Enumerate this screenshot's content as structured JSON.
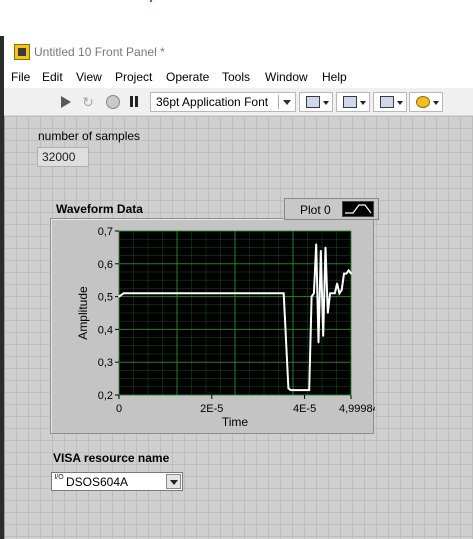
{
  "window": {
    "title": "Untitled 10 Front Panel *"
  },
  "menu": [
    "File",
    "Edit",
    "View",
    "Project",
    "Operate",
    "Tools",
    "Window",
    "Help"
  ],
  "toolbar": {
    "font_label": "36pt Application Font",
    "icons": [
      "run-arrow-icon",
      "run-continuous-icon",
      "abort-icon",
      "pause-icon",
      "align-icon",
      "distribute-icon",
      "resize-icon",
      "reorder-icon"
    ]
  },
  "controls": {
    "num_samples_label": "number of samples",
    "num_samples_value": "32000",
    "graph_label": "Waveform Data",
    "plot_legend": "Plot 0",
    "visa_label": "VISA resource name",
    "visa_value": "DSOS604A",
    "visa_icon_text": "I/O"
  },
  "colors": {
    "plot_bg": "#000000",
    "grid": "#2a8f2a",
    "trace": "#ffffff"
  },
  "chart_data": {
    "type": "line",
    "title": "",
    "xlabel": "Time",
    "ylabel": "Amplitude",
    "xlim": [
      0,
      4.999844e-05
    ],
    "ylim": [
      0.2,
      0.7
    ],
    "x_tick_labels": [
      "0",
      "2E-5",
      "4E-5",
      "4,999844E-"
    ],
    "y_tick_labels": [
      "0,2",
      "0,3",
      "0,4",
      "0,5",
      "0,6",
      "0,7"
    ],
    "grid": true,
    "series": [
      {
        "x": [
          0,
          1e-06,
          5e-06,
          1e-05,
          1.5e-05,
          2e-05,
          2.5e-05,
          3e-05,
          3.55e-05,
          3.65e-05,
          3.7e-05,
          3.8e-05,
          3.9e-05,
          4e-05,
          4.1e-05,
          4.15e-05,
          4.2e-05,
          4.25e-05,
          4.3e-05,
          4.35e-05,
          4.4e-05,
          4.45e-05,
          4.5e-05,
          4.55e-05,
          4.6e-05,
          4.65e-05,
          4.7e-05,
          4.75e-05,
          4.8e-05,
          4.85e-05,
          4.9e-05,
          4.95e-05,
          4.999844e-05
        ],
        "values": [
          0.5,
          0.51,
          0.51,
          0.51,
          0.51,
          0.51,
          0.51,
          0.51,
          0.51,
          0.22,
          0.215,
          0.215,
          0.215,
          0.215,
          0.215,
          0.5,
          0.51,
          0.66,
          0.36,
          0.64,
          0.38,
          0.65,
          0.45,
          0.51,
          0.51,
          0.51,
          0.54,
          0.51,
          0.52,
          0.57,
          0.57,
          0.58,
          0.57
        ]
      }
    ]
  }
}
